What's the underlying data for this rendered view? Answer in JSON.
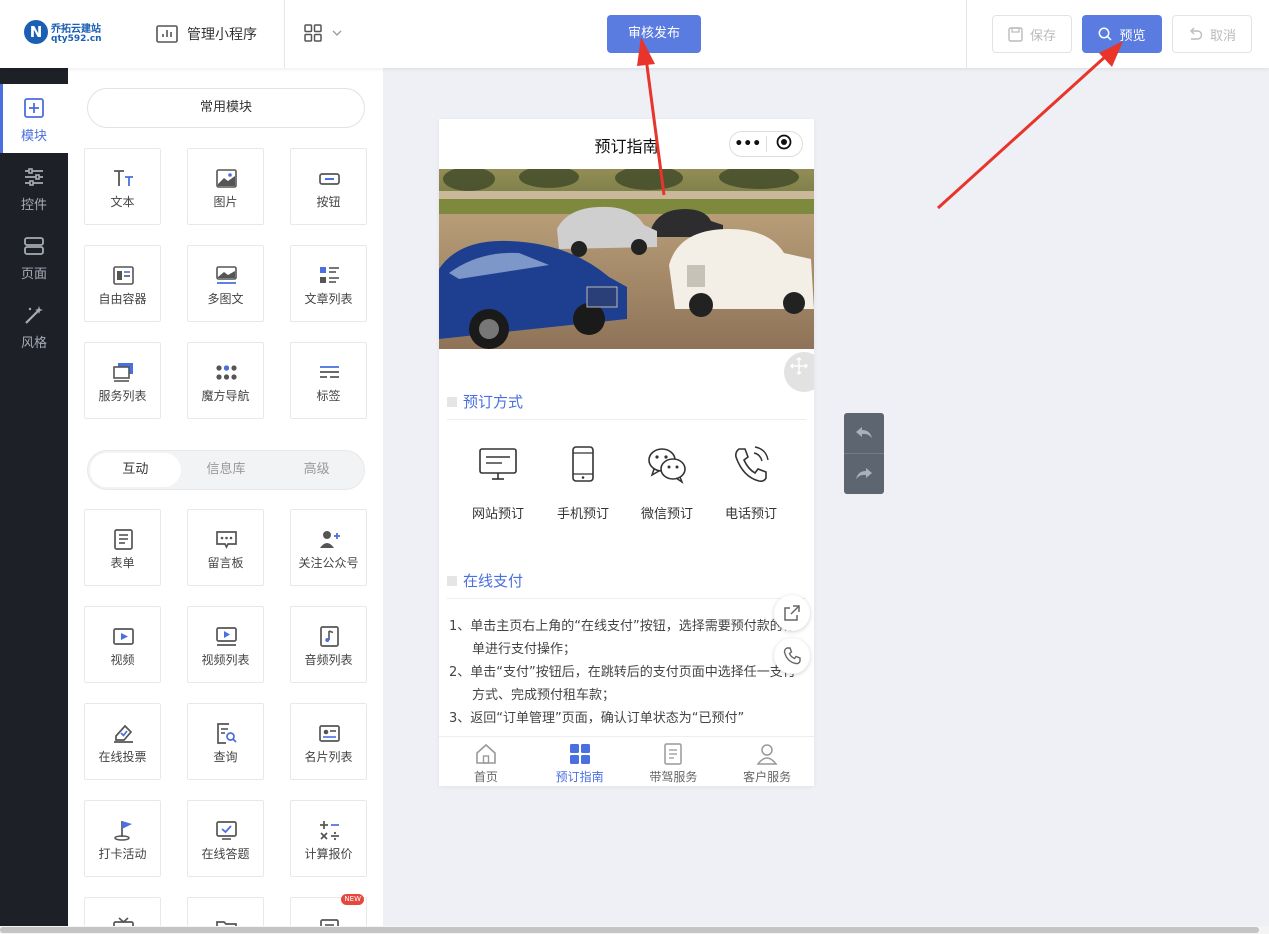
{
  "brand": {
    "name": "乔拓云建站",
    "domain": "qty592.cn"
  },
  "header": {
    "manage_label": "管理小程序",
    "review_publish": "审核发布",
    "save": "保存",
    "preview": "预览",
    "cancel": "取消"
  },
  "leftnav": [
    {
      "label": "模块",
      "icon": "plus-square-icon",
      "active": true
    },
    {
      "label": "控件",
      "icon": "sliders-icon",
      "active": false
    },
    {
      "label": "页面",
      "icon": "pages-icon",
      "active": false
    },
    {
      "label": "风格",
      "icon": "magic-wand-icon",
      "active": false
    }
  ],
  "panel": {
    "common_title": "常用模块",
    "common": [
      {
        "label": "文本",
        "icon": "text-icon"
      },
      {
        "label": "图片",
        "icon": "image-icon"
      },
      {
        "label": "按钮",
        "icon": "button-icon"
      },
      {
        "label": "自由容器",
        "icon": "container-icon"
      },
      {
        "label": "多图文",
        "icon": "multi-image-text-icon"
      },
      {
        "label": "文章列表",
        "icon": "article-list-icon"
      },
      {
        "label": "服务列表",
        "icon": "service-list-icon"
      },
      {
        "label": "魔方导航",
        "icon": "cube-nav-icon"
      },
      {
        "label": "标签",
        "icon": "tag-icon"
      }
    ],
    "tabs": [
      {
        "label": "互动",
        "active": true
      },
      {
        "label": "信息库",
        "active": false
      },
      {
        "label": "高级",
        "active": false
      }
    ],
    "interactive": [
      {
        "label": "表单",
        "icon": "form-icon"
      },
      {
        "label": "留言板",
        "icon": "message-board-icon"
      },
      {
        "label": "关注公众号",
        "icon": "follow-account-icon"
      },
      {
        "label": "视频",
        "icon": "video-icon"
      },
      {
        "label": "视频列表",
        "icon": "video-list-icon"
      },
      {
        "label": "音频列表",
        "icon": "audio-list-icon"
      },
      {
        "label": "在线投票",
        "icon": "vote-icon"
      },
      {
        "label": "查询",
        "icon": "query-icon"
      },
      {
        "label": "名片列表",
        "icon": "card-list-icon"
      },
      {
        "label": "打卡活动",
        "icon": "check-in-flag-icon"
      },
      {
        "label": "在线答题",
        "icon": "quiz-icon"
      },
      {
        "label": "计算报价",
        "icon": "calculator-icon"
      }
    ],
    "new_badge": "NEW"
  },
  "phone": {
    "title": "预订指南",
    "capsule_more": "•••",
    "section_booking": "预订方式",
    "booking_methods": [
      {
        "label": "网站预订",
        "icon": "monitor-icon"
      },
      {
        "label": "手机预订",
        "icon": "mobile-phone-icon"
      },
      {
        "label": "微信预订",
        "icon": "wechat-icon"
      },
      {
        "label": "电话预订",
        "icon": "telephone-icon"
      }
    ],
    "section_pay": "在线支付",
    "pay_steps": [
      "1、单击主页右上角的“在线支付”按钮，选择需要预付款的订单进行支付操作；",
      "2、单击“支付”按钮后，在跳转后的支付页面中选择任一支付方式、完成预付租车款；",
      "3、返回“订单管理”页面，确认订单状态为“已预付”"
    ],
    "tabs": [
      {
        "label": "首页",
        "icon": "home-icon",
        "active": false
      },
      {
        "label": "预订指南",
        "icon": "grid-icon",
        "active": true
      },
      {
        "label": "带驾服务",
        "icon": "document-icon",
        "active": false
      },
      {
        "label": "客户服务",
        "icon": "user-icon",
        "active": false
      }
    ]
  },
  "colors": {
    "accent": "#4a6fe0",
    "primary_button": "#5a7be0",
    "sidebar": "#1e2028",
    "annotation_arrow": "#e8342b"
  }
}
